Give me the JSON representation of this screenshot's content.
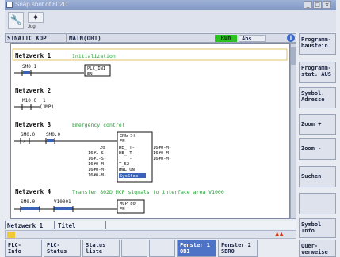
{
  "window": {
    "title": "Snap shot of 802D",
    "controls": [
      "_",
      "□",
      "×"
    ]
  },
  "toolbar": {
    "wrench_icon": "wrench-icon",
    "jog_icon": "jog-icon",
    "jog_label": "Jog"
  },
  "header": {
    "mode": "SINATIC KOP",
    "block": "MAIN(OB1)",
    "run_label": "Run",
    "abs_label": "Abs",
    "colors": {
      "run": "#2bc21f",
      "accent": "#4d73c7",
      "comment": "#22a235"
    }
  },
  "networks": [
    {
      "label": "Netzwerk 1",
      "comment": "Initialization",
      "contact": "SM0.1",
      "box": [
        "PLC_INI",
        "EN"
      ]
    },
    {
      "label": "Netzwerk 2",
      "contact": "M10.0",
      "jump": "1",
      "jump_label": "(JMP)"
    },
    {
      "label": "Netzwerk 3",
      "comment": "Emergency control",
      "contacts": [
        "SM0.0",
        "SM0.0"
      ],
      "box": [
        "EMG_ST",
        "EN"
      ],
      "pin_left": [
        "20",
        "16#1-S-",
        "16#1-S-",
        "16#0-M-",
        "16#0-M-",
        "16#0-M-"
      ],
      "pin_mid": [
        "DE_ T-",
        "DE_ T-",
        "T_ T-",
        "T_52",
        "HWL_ON",
        "SysStop"
      ],
      "pin_right": [
        "16#0-M-",
        "16#0-M-",
        "16#0-M-"
      ]
    },
    {
      "label": "Netzwerk 4",
      "comment": "Transfer 802D MCP signals to interface area V1000",
      "contacts": [
        "SM0.0",
        "V10001"
      ],
      "box": [
        "MCP_80",
        "EN"
      ]
    }
  ],
  "status": {
    "network": "Netzwerk 1",
    "title": "Titel"
  },
  "right_softkeys": [
    "Programm-\nbaustein",
    "Programm-\nstat. AUS",
    "Symbol.\nAdresse",
    "Zoom +",
    "Zoom -",
    "Suchen",
    "",
    "Symbol\nInfo",
    "Quer-\nverweise"
  ],
  "bottom_softkeys": [
    "PLC-\nInfo",
    "PLC-\nStatus",
    "Status\nliste",
    "",
    "",
    "Fenster 1\nOB1",
    "Fenster 2\nSBR0"
  ]
}
